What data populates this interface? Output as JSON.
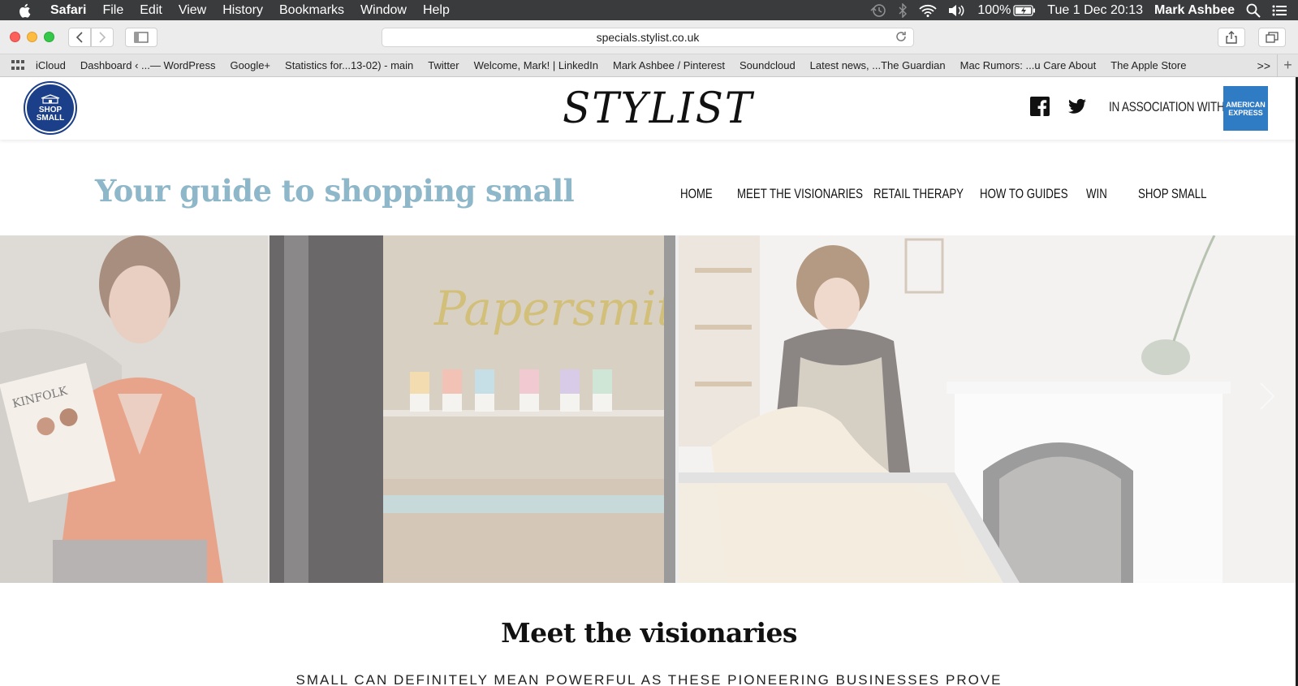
{
  "menubar": {
    "app": "Safari",
    "items": [
      "File",
      "Edit",
      "View",
      "History",
      "Bookmarks",
      "Window",
      "Help"
    ],
    "battery": "100%",
    "datetime": "Tue 1 Dec  20:13",
    "user": "Mark Ashbee"
  },
  "browser": {
    "url": "specials.stylist.co.uk",
    "bookmarks": [
      "iCloud",
      "Dashboard ‹ ...— WordPress",
      "Google+",
      "Statistics for...13-02) - main",
      "Twitter",
      "Welcome, Mark! | LinkedIn",
      "Mark Ashbee / Pinterest",
      "Soundcloud",
      "Latest news, ...The Guardian",
      "Mac Rumors: ...u Care About",
      "The Apple Store"
    ],
    "bookmarks_more": ">>"
  },
  "site": {
    "badge_line1": "SHOP",
    "badge_line2": "SMALL",
    "logo": "STYLIST",
    "association": "IN ASSOCIATION WITH",
    "amex_line1": "AMERICAN",
    "amex_line2": "EXPRESS",
    "tagline": "Your guide to shopping small",
    "nav": [
      "HOME",
      "MEET THE VISIONARIES",
      "RETAIL THERAPY",
      "HOW TO GUIDES",
      "WIN",
      "SHOP SMALL"
    ],
    "hero_sign": "Papersmiths",
    "hero_magazine": "KINFOLK",
    "section_title": "Meet the visionaries",
    "section_subtitle": "SMALL CAN DEFINITELY MEAN POWERFUL AS THESE PIONEERING BUSINESSES PROVE"
  },
  "colors": {
    "tagline": "#8eb7c9",
    "badge": "#1c3f8a",
    "amex": "#2f7bc4"
  }
}
